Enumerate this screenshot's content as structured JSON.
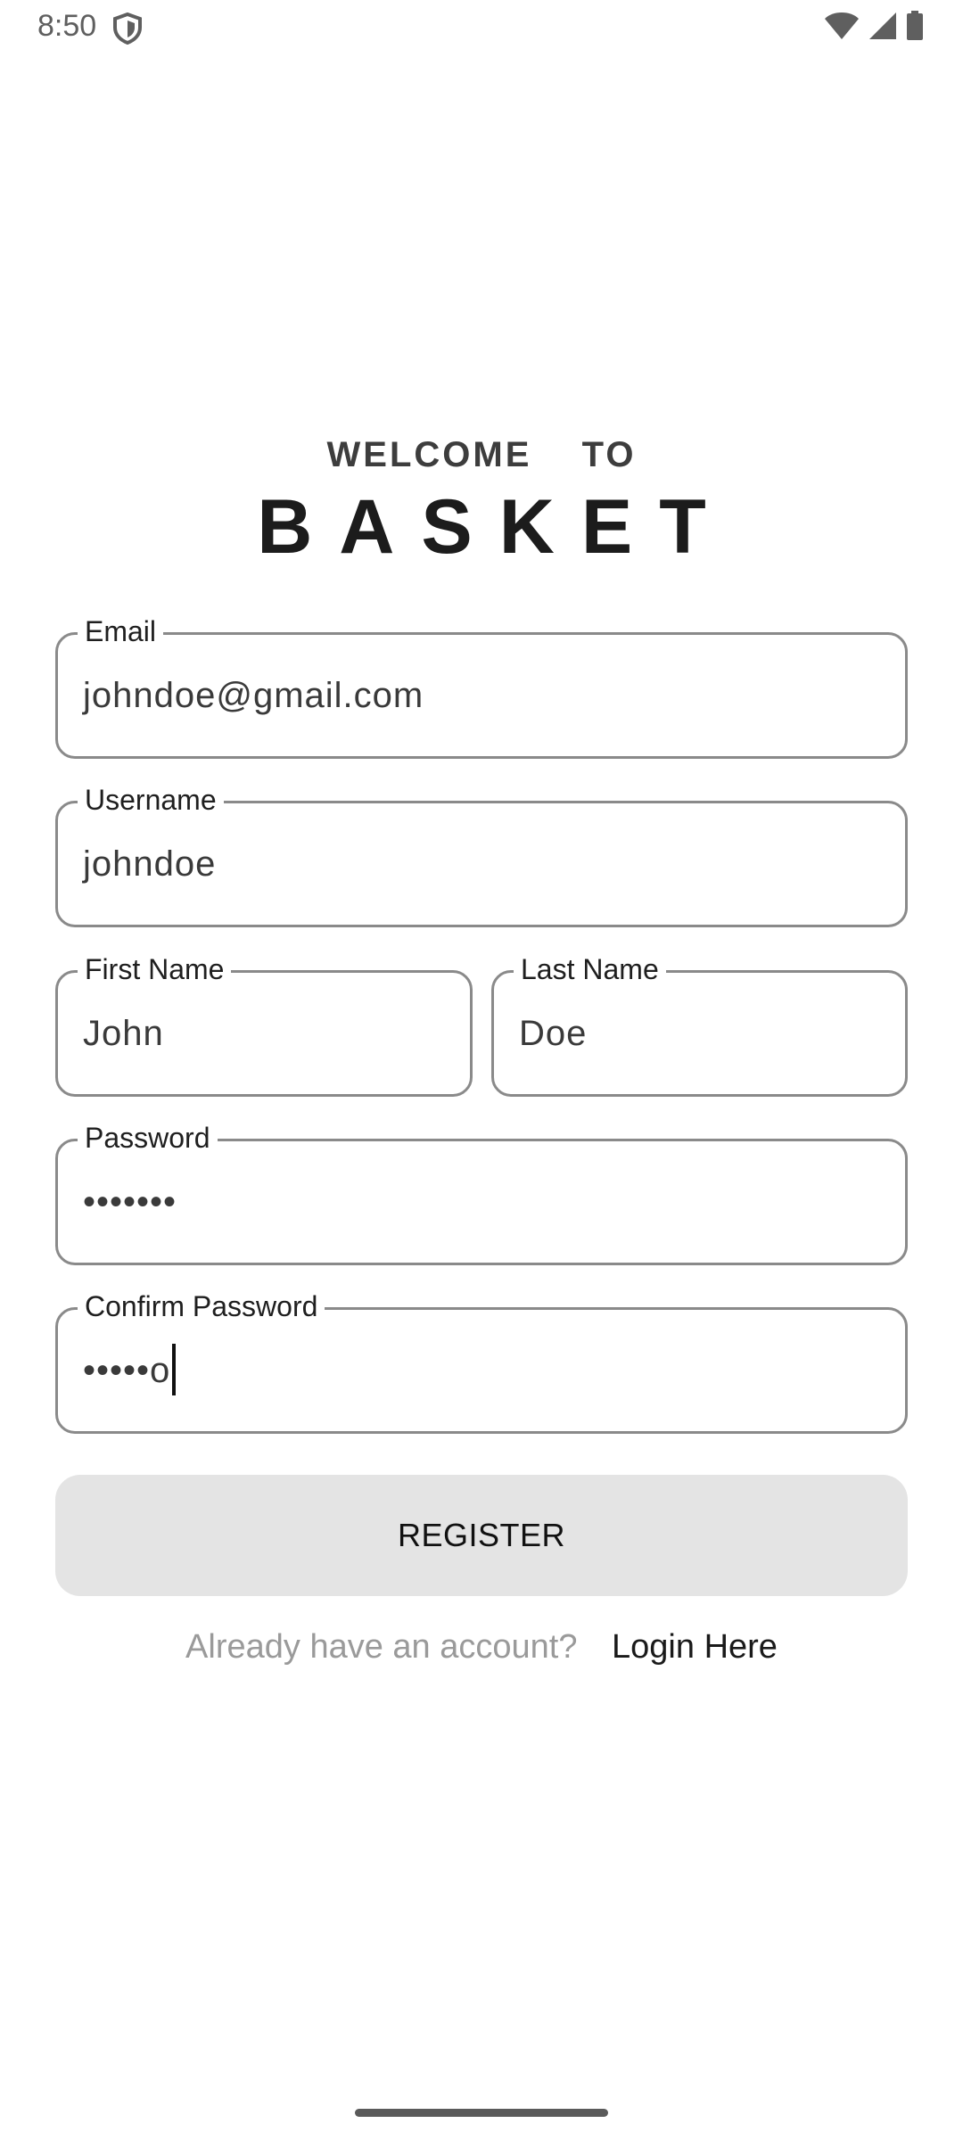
{
  "status_bar": {
    "time": "8:50",
    "icons": [
      "shield-icon",
      "wifi-icon",
      "signal-icon",
      "battery-icon"
    ]
  },
  "header": {
    "welcome": "WELCOME  TO",
    "brand": "BASKET"
  },
  "form": {
    "email": {
      "label": "Email",
      "value": "johndoe@gmail.com"
    },
    "username": {
      "label": "Username",
      "value": "johndoe"
    },
    "first_name": {
      "label": "First Name",
      "value": "John"
    },
    "last_name": {
      "label": "Last Name",
      "value": "Doe"
    },
    "password": {
      "label": "Password",
      "value": "•••••••"
    },
    "confirm_password": {
      "label": "Confirm Password",
      "value": "•••••o"
    },
    "register_label": "REGISTER"
  },
  "footer": {
    "prompt": "Already have an account?",
    "link": "Login Here"
  },
  "colors": {
    "field_border": "#8a8a8a",
    "button_bg": "#e4e4e4",
    "prompt_text": "#9a9a9a"
  }
}
